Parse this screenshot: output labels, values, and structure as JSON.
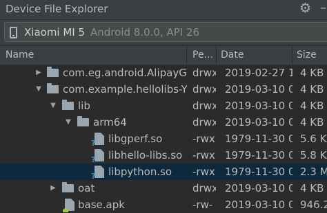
{
  "window": {
    "title": "Device File Explorer",
    "gear_icon": "gear-icon",
    "minimize_icon": "minimize-icon"
  },
  "device": {
    "name": "Xiaomi MI 5",
    "api": "Android 8.0.0, API 26"
  },
  "columns": [
    "Name",
    "Pe...",
    "Date",
    "Size"
  ],
  "rows": [
    {
      "name": "com.eg.android.AlipayG",
      "perm": "drwx",
      "date": "2019-02-27 1",
      "size": "4 KB"
    },
    {
      "name": "com.example.hellolibs-Y",
      "perm": "drwx",
      "date": "2019-03-10 0",
      "size": "4 KB"
    },
    {
      "name": "lib",
      "perm": "drwx",
      "date": "2019-03-10 0",
      "size": "4 KB"
    },
    {
      "name": "arm64",
      "perm": "drwx",
      "date": "2019-03-10 0",
      "size": "4 KB"
    },
    {
      "name": "libgperf.so",
      "perm": "-rwx",
      "date": "1979-11-30 0",
      "size": "5.6 K"
    },
    {
      "name": "libhello-libs.so",
      "perm": "-rwx",
      "date": "1979-11-30 0",
      "size": "5.8 K"
    },
    {
      "name": "libpython.so",
      "perm": "-rwx",
      "date": "1979-11-30 0",
      "size": "2.3 M"
    },
    {
      "name": "oat",
      "perm": "drwx",
      "date": "2019-03-10 0",
      "size": "4 KB"
    },
    {
      "name": "base.apk",
      "perm": "-rw-",
      "date": "2019-03-10 0",
      "size": "946.2"
    }
  ]
}
